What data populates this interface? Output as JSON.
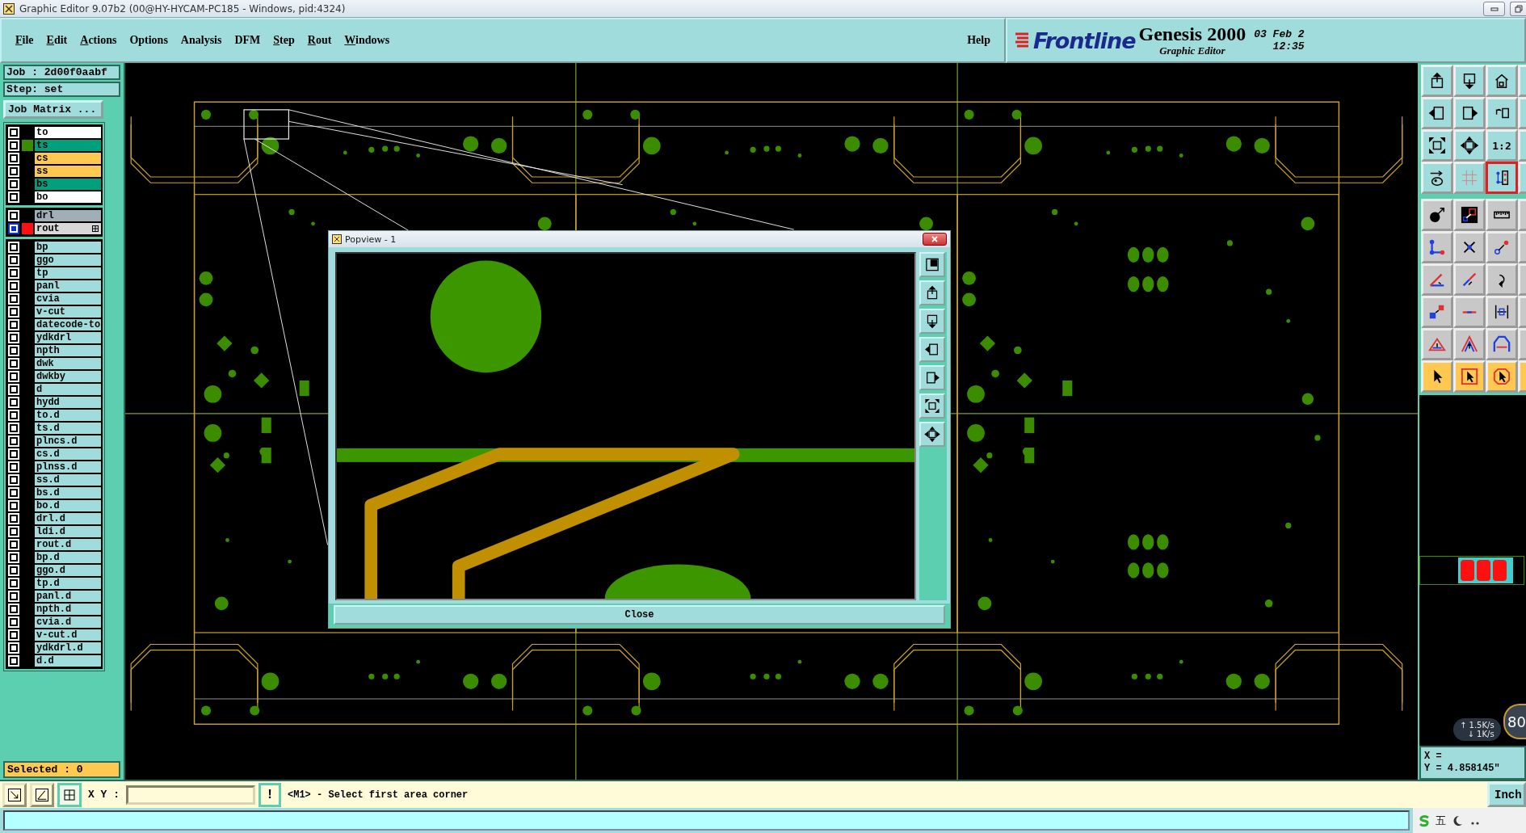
{
  "window": {
    "title": "Graphic Editor 9.07b2 (00@HY-HYCAM-PC185 - Windows, pid:4324)"
  },
  "menu": [
    {
      "label": "File",
      "mnemonic": true
    },
    {
      "label": "Edit",
      "mnemonic": true
    },
    {
      "label": "Actions",
      "mnemonic": true
    },
    {
      "label": "Options",
      "mnemonic": false
    },
    {
      "label": "Analysis",
      "mnemonic": false
    },
    {
      "label": "DFM",
      "mnemonic": false
    },
    {
      "label": "Step",
      "mnemonic": true
    },
    {
      "label": "Rout",
      "mnemonic": true
    },
    {
      "label": "Windows",
      "mnemonic": true
    }
  ],
  "help": "Help",
  "brand": {
    "logo": "Frontline",
    "product": "Genesis 2000",
    "subtitle": "Graphic Editor",
    "date": "03 Feb 2",
    "time": "12:35"
  },
  "job": {
    "job": "Job : 2d00f0aabf",
    "step": "Step: set",
    "matrix_button": "Job Matrix ..."
  },
  "layer_groups": [
    {
      "layers": [
        {
          "name": "to",
          "kind": "silk",
          "work": false
        },
        {
          "name": "ts",
          "kind": "mask",
          "color": "#3c8c00",
          "work": false
        },
        {
          "name": "cs",
          "kind": "signal",
          "work": false
        },
        {
          "name": "ss",
          "kind": "signal",
          "work": false
        },
        {
          "name": "bs",
          "kind": "mask",
          "work": false
        },
        {
          "name": "bo",
          "kind": "silk",
          "work": false
        }
      ]
    },
    {
      "layers": [
        {
          "name": "drl",
          "kind": "drill",
          "work": false
        },
        {
          "name": "rout",
          "kind": "rout",
          "color": "#ff1010",
          "work": true
        }
      ]
    },
    {
      "layers": [
        {
          "name": "bp",
          "kind": "misc",
          "work": false
        },
        {
          "name": "ggo",
          "kind": "misc",
          "work": false
        },
        {
          "name": "tp",
          "kind": "misc",
          "work": false
        },
        {
          "name": "panl",
          "kind": "misc",
          "work": false
        },
        {
          "name": "cvia",
          "kind": "misc",
          "work": false
        },
        {
          "name": "v-cut",
          "kind": "misc",
          "work": false
        },
        {
          "name": "datecode-to",
          "kind": "misc",
          "work": false
        },
        {
          "name": "ydkdrl",
          "kind": "misc",
          "work": false
        },
        {
          "name": "npth",
          "kind": "misc",
          "work": false
        },
        {
          "name": "dwk",
          "kind": "misc",
          "work": false
        },
        {
          "name": "dwkby",
          "kind": "misc",
          "work": false
        },
        {
          "name": "d",
          "kind": "misc",
          "work": false
        },
        {
          "name": "hydd",
          "kind": "misc",
          "work": false
        },
        {
          "name": "to.d",
          "kind": "misc",
          "work": false
        },
        {
          "name": "ts.d",
          "kind": "misc",
          "work": false
        },
        {
          "name": "plncs.d",
          "kind": "misc",
          "work": false
        },
        {
          "name": "cs.d",
          "kind": "misc",
          "work": false
        },
        {
          "name": "plnss.d",
          "kind": "misc",
          "work": false
        },
        {
          "name": "ss.d",
          "kind": "misc",
          "work": false
        },
        {
          "name": "bs.d",
          "kind": "misc",
          "work": false
        },
        {
          "name": "bo.d",
          "kind": "misc",
          "work": false
        },
        {
          "name": "drl.d",
          "kind": "misc",
          "work": false
        },
        {
          "name": "ldi.d",
          "kind": "misc",
          "work": false
        },
        {
          "name": "rout.d",
          "kind": "misc",
          "work": false
        },
        {
          "name": "bp.d",
          "kind": "misc",
          "work": false
        },
        {
          "name": "ggo.d",
          "kind": "misc",
          "work": false
        },
        {
          "name": "tp.d",
          "kind": "misc",
          "work": false
        },
        {
          "name": "panl.d",
          "kind": "misc",
          "work": false
        },
        {
          "name": "npth.d",
          "kind": "misc",
          "work": false
        },
        {
          "name": "cvia.d",
          "kind": "misc",
          "work": false
        },
        {
          "name": "v-cut.d",
          "kind": "misc",
          "work": false
        },
        {
          "name": "ydkdrl.d",
          "kind": "misc",
          "work": false
        },
        {
          "name": "d.d",
          "kind": "misc",
          "work": false
        }
      ]
    }
  ],
  "selected_count": "Selected : 0",
  "popview": {
    "title": "Popview - 1",
    "close_button": "Close"
  },
  "toolbar": [
    {
      "kind": "view",
      "buttons": [
        {
          "selected": false
        },
        {
          "selected": false
        },
        {
          "selected": false
        },
        {
          "selected": false
        }
      ]
    },
    {
      "kind": "view",
      "buttons": [
        {
          "selected": false
        },
        {
          "selected": false
        },
        {
          "selected": false
        },
        {
          "selected": false
        }
      ]
    },
    {
      "kind": "view",
      "buttons": [
        {
          "selected": false
        },
        {
          "selected": false
        },
        {
          "selected": false,
          "label": "1:2"
        },
        {
          "selected": false
        }
      ]
    },
    {
      "kind": "view",
      "buttons": [
        {
          "selected": false
        },
        {
          "selected": false
        },
        {
          "selected": true
        },
        {
          "selected": false
        }
      ]
    },
    {
      "kind": "edit",
      "buttons": [
        {
          "selected": false
        },
        {
          "selected": false
        },
        {
          "selected": false
        },
        {
          "selected": false
        }
      ]
    },
    {
      "kind": "edit",
      "buttons": [
        {
          "selected": false
        },
        {
          "selected": false
        },
        {
          "selected": false
        },
        {
          "selected": false
        }
      ]
    },
    {
      "kind": "edit",
      "buttons": [
        {
          "selected": false
        },
        {
          "selected": false
        },
        {
          "selected": false
        },
        {
          "selected": false
        }
      ]
    },
    {
      "kind": "edit",
      "buttons": [
        {
          "selected": false
        },
        {
          "selected": false
        },
        {
          "selected": false
        },
        {
          "selected": false
        }
      ]
    },
    {
      "kind": "edit",
      "buttons": [
        {
          "selected": false
        },
        {
          "selected": false
        },
        {
          "selected": false
        },
        {
          "selected": false
        }
      ]
    },
    {
      "kind": "select",
      "buttons": [
        {
          "selected": false
        },
        {
          "selected": false
        },
        {
          "selected": false
        },
        {
          "selected": false
        }
      ]
    }
  ],
  "readout": {
    "x": "X =",
    "y": "Y = 4.858145\""
  },
  "net_monitor": {
    "upload": "↑ 1.5K/s",
    "download": "↓ 1K/s",
    "gauge": "80"
  },
  "command_bar": {
    "tools": [
      {
        "selected": false
      },
      {
        "selected": false
      },
      {
        "selected": true
      }
    ],
    "xy_label": "X Y :",
    "alert_button": "!",
    "message": "<M1> - Select first area corner",
    "units_button": "Inch"
  },
  "tray": {
    "ime": "五"
  }
}
